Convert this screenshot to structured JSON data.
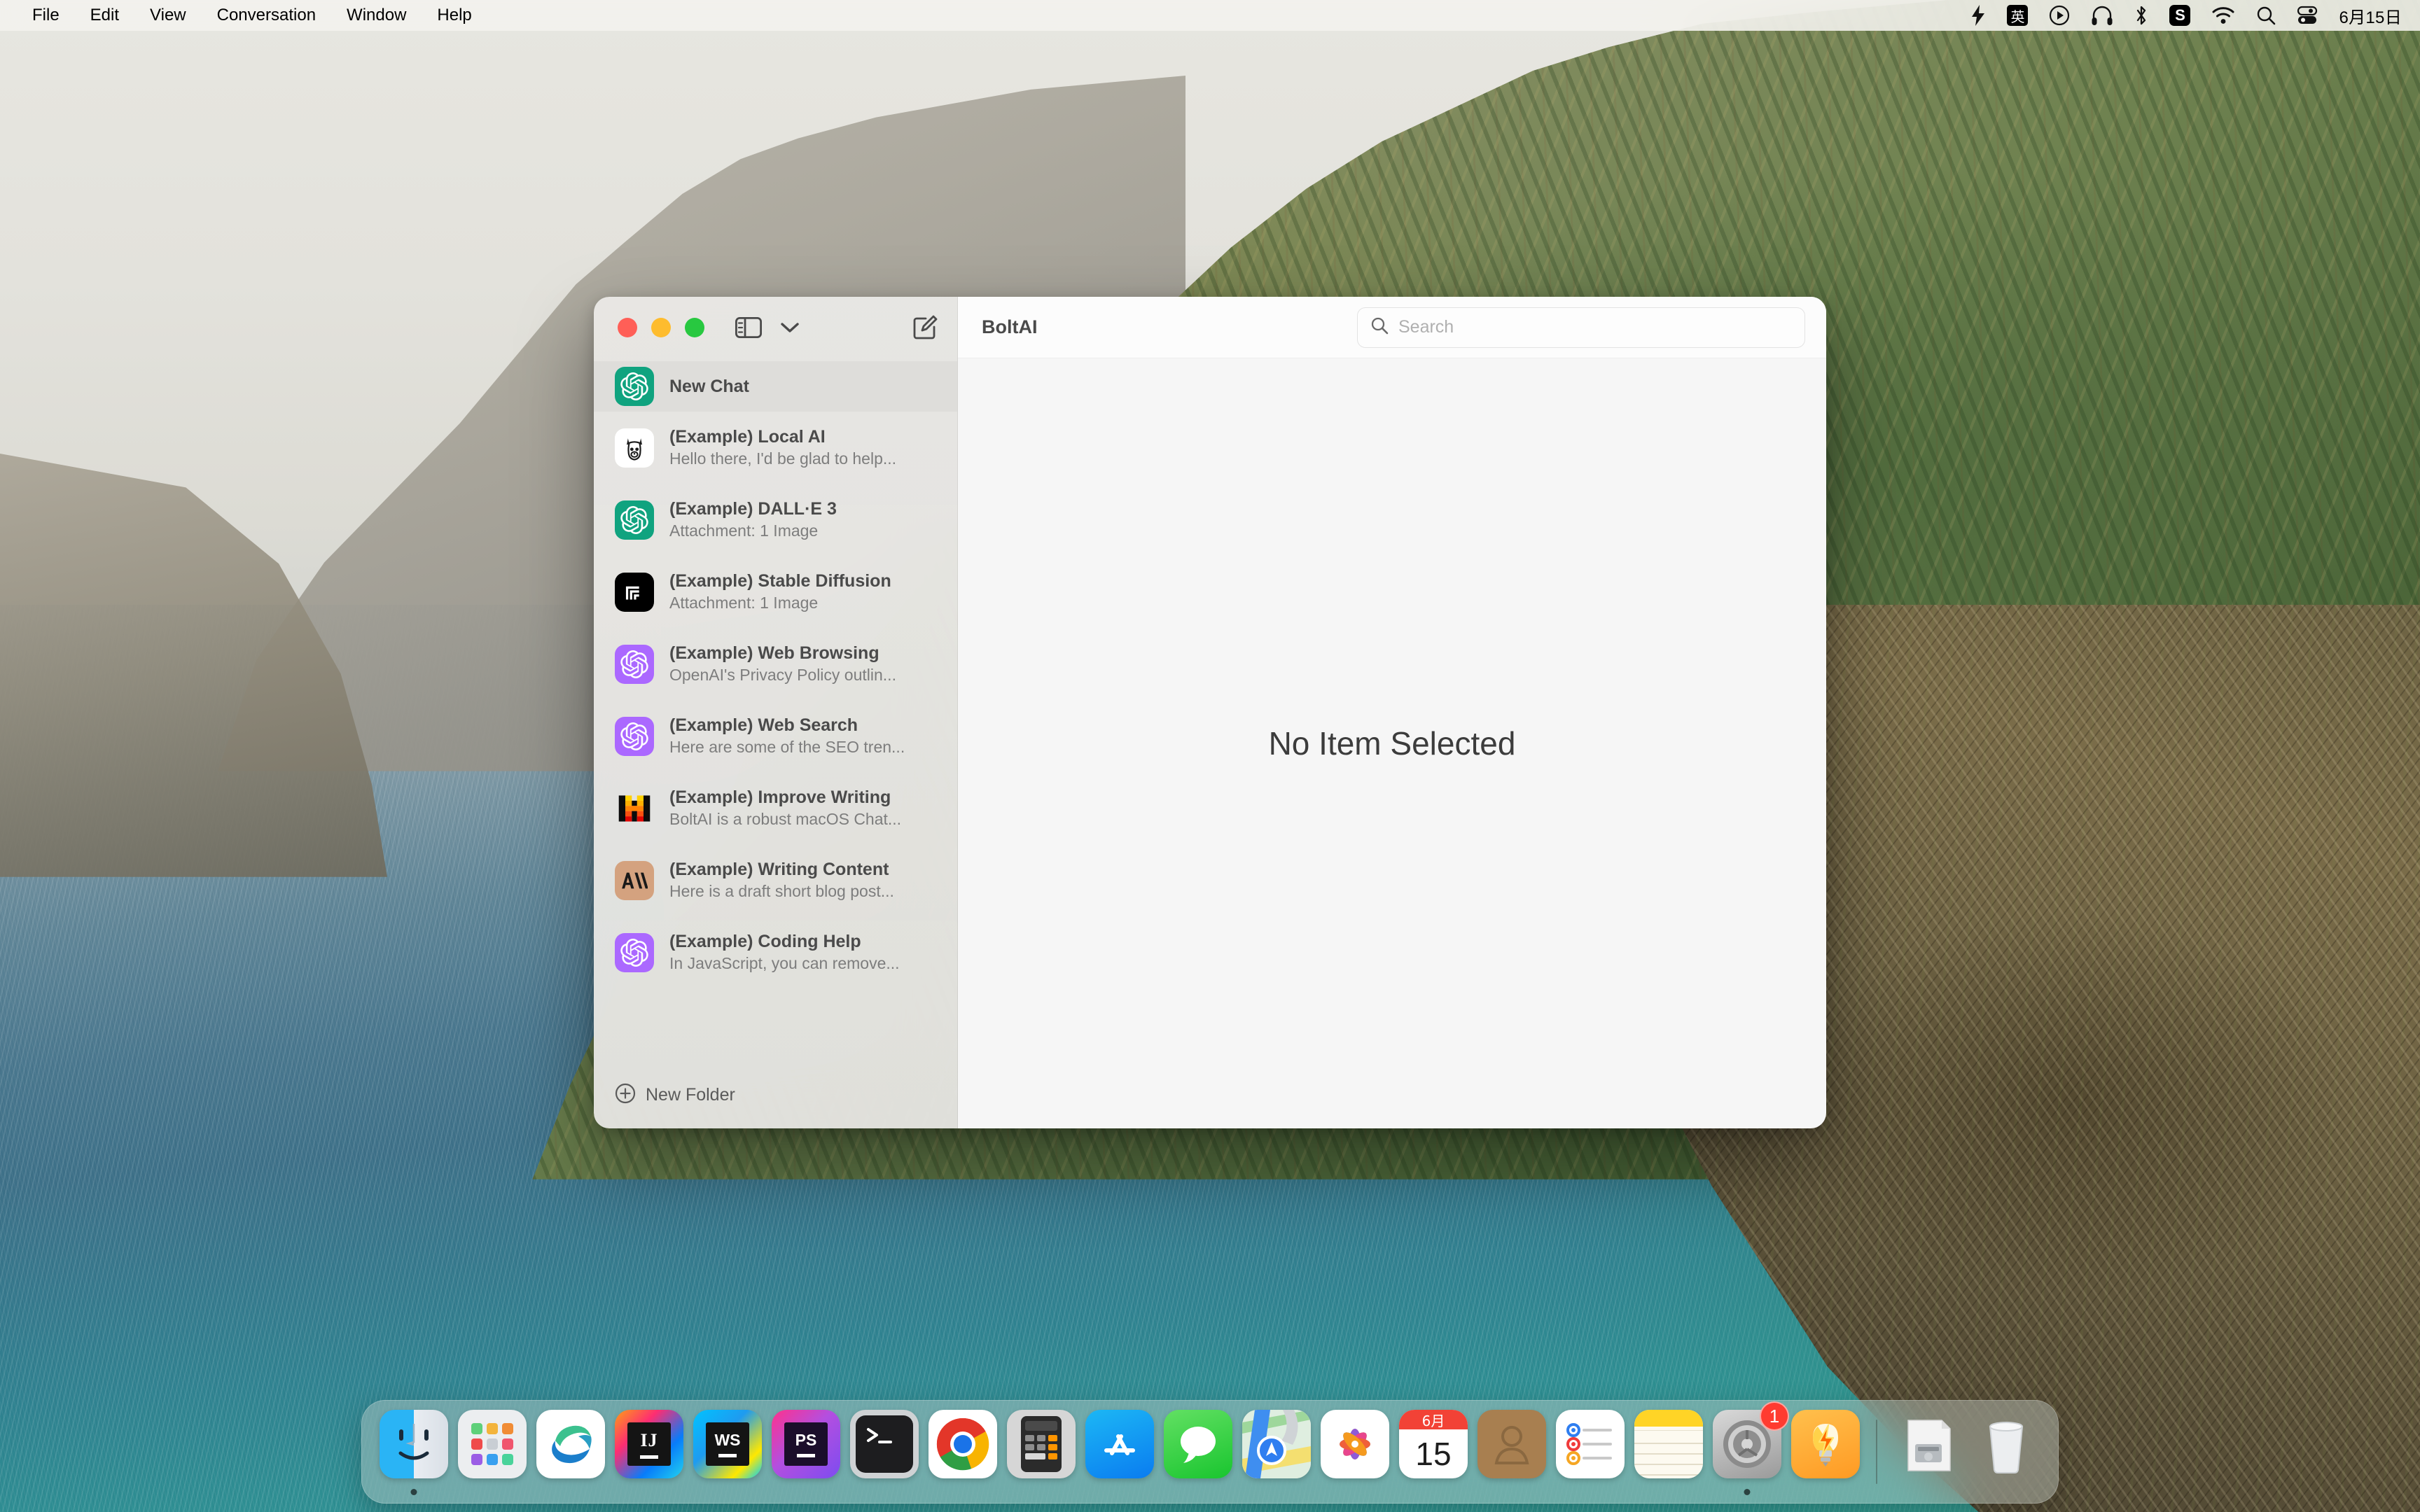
{
  "menubar": {
    "items": [
      "File",
      "Edit",
      "View",
      "Conversation",
      "Window",
      "Help"
    ],
    "status_icons": [
      "bolt-icon",
      "input-method-icon",
      "play-circle-icon",
      "headphones-icon",
      "bluetooth-icon",
      "snipaste-icon",
      "wifi-icon",
      "search-icon",
      "control-center-icon"
    ],
    "input_method_label": "英",
    "snipaste_label": "S",
    "clock": "6月15日"
  },
  "window": {
    "traffic_lights": [
      "close-button",
      "minimize-button",
      "zoom-button"
    ],
    "toolbar_icons": [
      "sidebar-toggle-icon",
      "chevron-down-icon",
      "compose-icon"
    ],
    "content": {
      "title": "BoltAI",
      "search_placeholder": "Search",
      "search_value": "",
      "empty_state": "No Item Selected"
    },
    "sidebar": {
      "new_folder_label": "New Folder",
      "items": [
        {
          "title": "New Chat",
          "subtitle": "",
          "icon": "openai-icon",
          "avatar": "green",
          "selected": true
        },
        {
          "title": "(Example) Local AI",
          "subtitle": "Hello there, I'd be glad to help...",
          "icon": "llama-icon",
          "avatar": "white",
          "selected": false
        },
        {
          "title": "(Example) DALL·E 3",
          "subtitle": "Attachment: 1 Image",
          "icon": "openai-icon",
          "avatar": "green",
          "selected": false
        },
        {
          "title": "(Example) Stable Diffusion",
          "subtitle": "Attachment: 1 Image",
          "icon": "stability-icon",
          "avatar": "black",
          "selected": false
        },
        {
          "title": "(Example) Web Browsing",
          "subtitle": "OpenAI's Privacy Policy outlin...",
          "icon": "openai-icon",
          "avatar": "purple",
          "selected": false
        },
        {
          "title": "(Example) Web Search",
          "subtitle": "Here are some of the SEO tren...",
          "icon": "openai-icon",
          "avatar": "purple",
          "selected": false
        },
        {
          "title": "(Example) Improve Writing",
          "subtitle": "BoltAI is a robust macOS Chat...",
          "icon": "mistral-icon",
          "avatar": "plain",
          "selected": false
        },
        {
          "title": "(Example) Writing Content",
          "subtitle": "Here is a draft short blog post...",
          "icon": "anthropic-icon",
          "avatar": "tan",
          "selected": false
        },
        {
          "title": "(Example) Coding Help",
          "subtitle": "In JavaScript, you can remove...",
          "icon": "openai-icon",
          "avatar": "purple",
          "selected": false
        }
      ]
    }
  },
  "dock": {
    "items": [
      {
        "name": "finder",
        "label": "Finder",
        "running": true
      },
      {
        "name": "launchpad",
        "label": "Launchpad",
        "running": false
      },
      {
        "name": "edge",
        "label": "Microsoft Edge",
        "running": false
      },
      {
        "name": "intellij-idea",
        "label": "IntelliJ IDEA",
        "running": false
      },
      {
        "name": "webstorm",
        "label": "WebStorm",
        "running": false
      },
      {
        "name": "phpstorm",
        "label": "PhpStorm",
        "running": false
      },
      {
        "name": "terminal",
        "label": "Terminal",
        "running": false
      },
      {
        "name": "chrome",
        "label": "Google Chrome",
        "running": false
      },
      {
        "name": "calculator",
        "label": "Calculator",
        "running": false
      },
      {
        "name": "app-store",
        "label": "App Store",
        "running": false
      },
      {
        "name": "messages",
        "label": "Messages",
        "running": false
      },
      {
        "name": "maps",
        "label": "Maps",
        "running": false
      },
      {
        "name": "photos",
        "label": "Photos",
        "running": false
      },
      {
        "name": "calendar",
        "label": "Calendar",
        "running": false,
        "month": "6月",
        "day": "15"
      },
      {
        "name": "contacts",
        "label": "Contacts",
        "running": false
      },
      {
        "name": "reminders",
        "label": "Reminders",
        "running": false
      },
      {
        "name": "notes",
        "label": "Notes",
        "running": false
      },
      {
        "name": "system-settings",
        "label": "System Settings",
        "running": true,
        "badge": "1"
      },
      {
        "name": "boltai",
        "label": "BoltAI",
        "running": false
      }
    ],
    "right_items": [
      {
        "name": "downloads-stack",
        "label": "Downloads"
      },
      {
        "name": "trash",
        "label": "Trash"
      }
    ]
  },
  "colors": {
    "openai_green": "#10a37f",
    "openai_purple": "#ab68ff",
    "anthropic_tan": "#d4a27f",
    "badge_red": "#ff3b30",
    "traffic_red": "#ff5f57",
    "traffic_yellow": "#febc2e",
    "traffic_green": "#28c840"
  }
}
